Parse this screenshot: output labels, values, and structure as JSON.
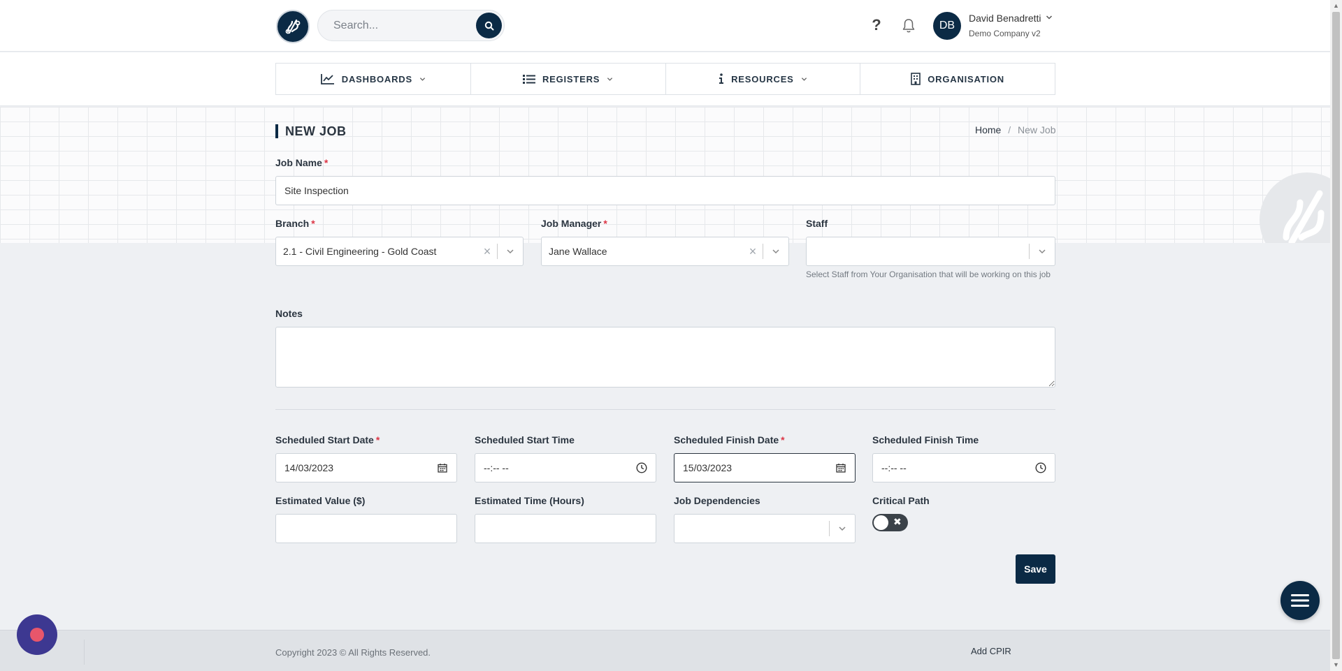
{
  "header": {
    "search_placeholder": "Search...",
    "help_label": "?",
    "user": {
      "initials": "DB",
      "name": "David Benadretti",
      "company": "Demo Company v2"
    }
  },
  "nav": [
    {
      "label": "DASHBOARDS",
      "icon": "chart-line-icon",
      "has_dropdown": true
    },
    {
      "label": "REGISTERS",
      "icon": "list-icon",
      "has_dropdown": true
    },
    {
      "label": "RESOURCES",
      "icon": "info-icon",
      "has_dropdown": true
    },
    {
      "label": "ORGANISATION",
      "icon": "building-icon",
      "has_dropdown": false
    }
  ],
  "page": {
    "title": "NEW JOB",
    "breadcrumb": {
      "home": "Home",
      "separator": "/",
      "current": "New Job"
    }
  },
  "form": {
    "job_name": {
      "label": "Job Name",
      "required": "*",
      "value": "Site Inspection"
    },
    "branch": {
      "label": "Branch",
      "required": "*",
      "value": "2.1 - Civil Engineering - Gold Coast"
    },
    "job_manager": {
      "label": "Job Manager",
      "required": "*",
      "value": "Jane Wallace"
    },
    "staff": {
      "label": "Staff",
      "value": "",
      "help": "Select Staff from Your Organisation that will be working on this job"
    },
    "notes": {
      "label": "Notes",
      "value": ""
    },
    "start_date": {
      "label": "Scheduled Start Date",
      "required": "*",
      "value": "14/03/2023"
    },
    "start_time": {
      "label": "Scheduled Start Time",
      "value": "--:-- --"
    },
    "finish_date": {
      "label": "Scheduled Finish Date",
      "required": "*",
      "value": "15/03/2023"
    },
    "finish_time": {
      "label": "Scheduled Finish Time",
      "value": "--:-- --"
    },
    "estimated_value": {
      "label": "Estimated Value ($)",
      "value": ""
    },
    "estimated_time": {
      "label": "Estimated Time (Hours)",
      "value": ""
    },
    "job_dependencies": {
      "label": "Job Dependencies",
      "value": ""
    },
    "critical_path": {
      "label": "Critical Path",
      "enabled": false,
      "symbol": "✖"
    },
    "save_label": "Save"
  },
  "footer": {
    "copyright": "Copyright 2023 © All Rights Reserved.",
    "add_cpir": "Add CPIR"
  },
  "colors": {
    "brand": "#0b2a45",
    "required": "#dc3545",
    "chat": "#3d3891",
    "chat_dot": "#e8566b"
  }
}
